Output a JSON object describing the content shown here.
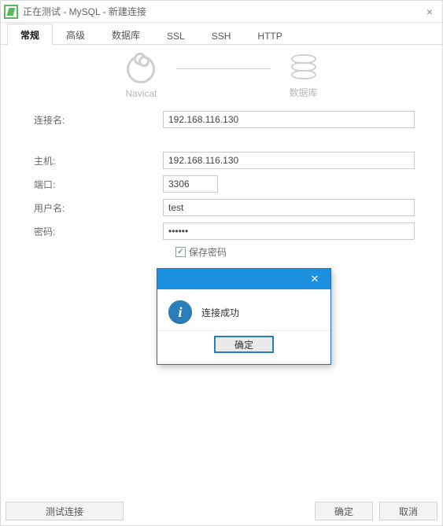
{
  "window": {
    "title": "正在测试 - MySQL - 新建连接"
  },
  "tabs": [
    {
      "label": "常规",
      "active": true
    },
    {
      "label": "高级",
      "active": false
    },
    {
      "label": "数据库",
      "active": false
    },
    {
      "label": "SSL",
      "active": false
    },
    {
      "label": "SSH",
      "active": false
    },
    {
      "label": "HTTP",
      "active": false
    }
  ],
  "hero": {
    "left_label": "Navicat",
    "right_label": "数据库"
  },
  "form": {
    "connection_name": {
      "label": "连接名:",
      "value": "192.168.116.130"
    },
    "host": {
      "label": "主机:",
      "value": "192.168.116.130"
    },
    "port": {
      "label": "端口:",
      "value": "3306"
    },
    "username": {
      "label": "用户名:",
      "value": "test"
    },
    "password": {
      "label": "密码:",
      "value": "••••••"
    },
    "save_password": {
      "label": "保存密码",
      "checked": true
    }
  },
  "footer": {
    "test_connection": "测试连接",
    "ok": "确定",
    "cancel": "取消"
  },
  "modal": {
    "message": "连接成功",
    "ok": "确定"
  }
}
